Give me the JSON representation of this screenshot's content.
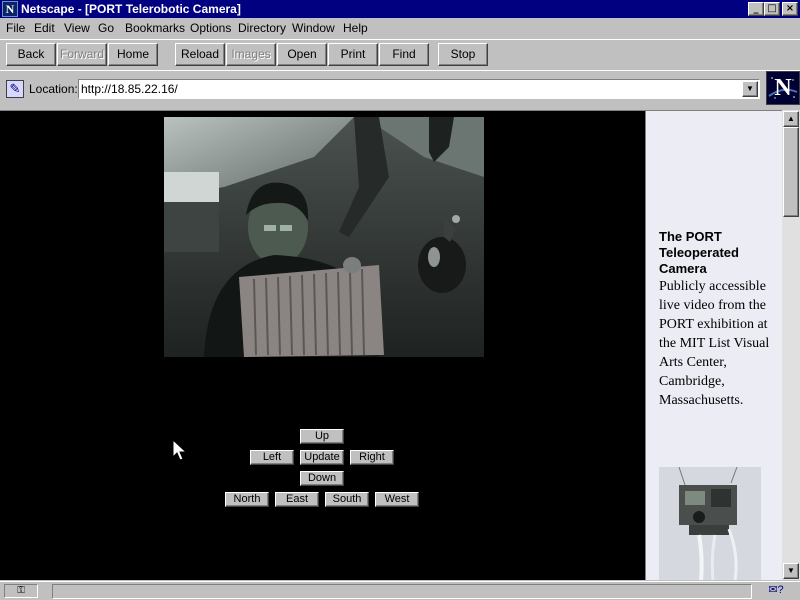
{
  "window": {
    "title": "Netscape - [PORT Telerobotic Camera]",
    "app_icon": "N",
    "controls": {
      "minimize": "_",
      "maximize": "□",
      "close": "×"
    }
  },
  "menu": {
    "items": [
      "File",
      "Edit",
      "View",
      "Go",
      "Bookmarks",
      "Options",
      "Directory",
      "Window",
      "Help"
    ]
  },
  "toolbar": {
    "back": "Back",
    "forward": "Forward",
    "home": "Home",
    "reload": "Reload",
    "images": "Images",
    "open": "Open",
    "print": "Print",
    "find": "Find",
    "stop": "Stop"
  },
  "location": {
    "label": "Location:",
    "url": "http://18.85.22.16/",
    "logo": "N"
  },
  "controls": {
    "up": "Up",
    "left": "Left",
    "update": "Update",
    "right": "Right",
    "down": "Down",
    "north": "North",
    "east": "East",
    "south": "South",
    "west": "West"
  },
  "sidebar": {
    "heading": "The PORT Teleoperated Camera",
    "description": "Publicly accessible live video from the PORT exhibition at the MIT List Visual Arts Center, Cambridge, Massachusetts."
  },
  "colors": {
    "titlebar": "#000080",
    "chrome": "#c0c0c0",
    "page_background": "#000000",
    "sidebar_background": "#ececf4"
  },
  "icons": {
    "bookmark": "bookmark-quill-icon",
    "security": "security-key-icon",
    "mail": "mail-icon",
    "scroll_up": "scroll-up-arrow-icon",
    "scroll_down": "scroll-down-arrow-icon",
    "cursor": "mouse-pointer-icon"
  }
}
